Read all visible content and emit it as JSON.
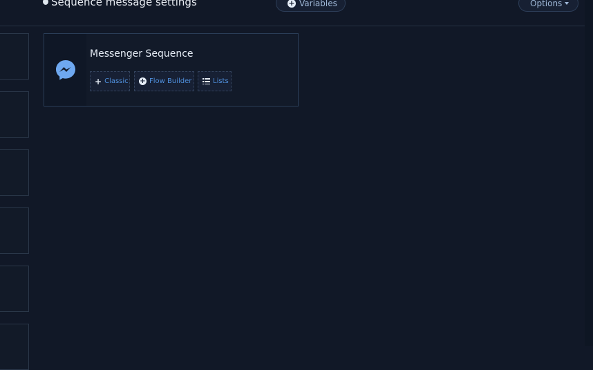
{
  "header": {
    "title": "Sequence message settings",
    "variables_label": "Variables",
    "options_label": "Options"
  },
  "sequence_card": {
    "title": "Messenger Sequence",
    "icon": "messenger-icon",
    "buttons": [
      {
        "label": "Classic",
        "icon": "plus-icon"
      },
      {
        "label": "Flow Builder",
        "icon": "plus-circle-icon"
      },
      {
        "label": "Lists",
        "icon": "list-icon"
      }
    ]
  },
  "colors": {
    "background": "#111827",
    "accent": "#4f8fdc",
    "messenger": "#6ea8f0"
  }
}
